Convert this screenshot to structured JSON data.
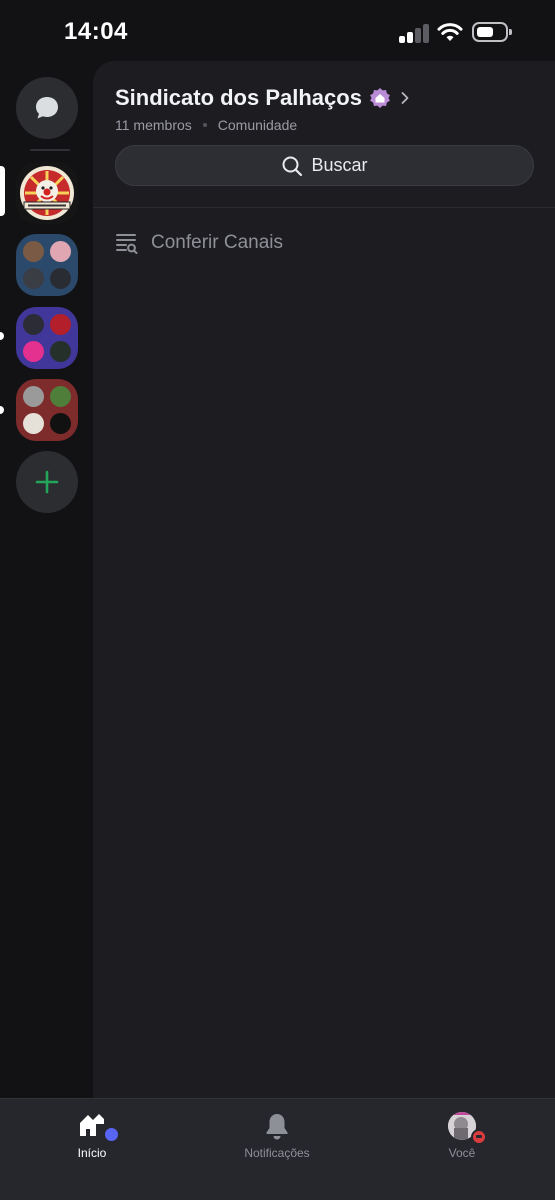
{
  "status_bar": {
    "time": "14:04"
  },
  "guild": {
    "name": "Sindicato dos Palhaços",
    "members": "11 membros",
    "type": "Comunidade",
    "search_label": "Buscar",
    "browse_channels_label": "Conferir Canais"
  },
  "tabs": [
    {
      "label": "Início",
      "icon": "home-icon",
      "active": true
    },
    {
      "label": "Notificações",
      "icon": "bell-icon",
      "active": false
    },
    {
      "label": "Você",
      "icon": "avatar",
      "active": false
    }
  ],
  "colors": {
    "background": "#121214",
    "panel": "#1d1d21",
    "accent_blurple": "#5865f2",
    "add_green": "#23a55a",
    "dnd_red": "#d83c3e",
    "community_badge": "#b98cd6"
  }
}
